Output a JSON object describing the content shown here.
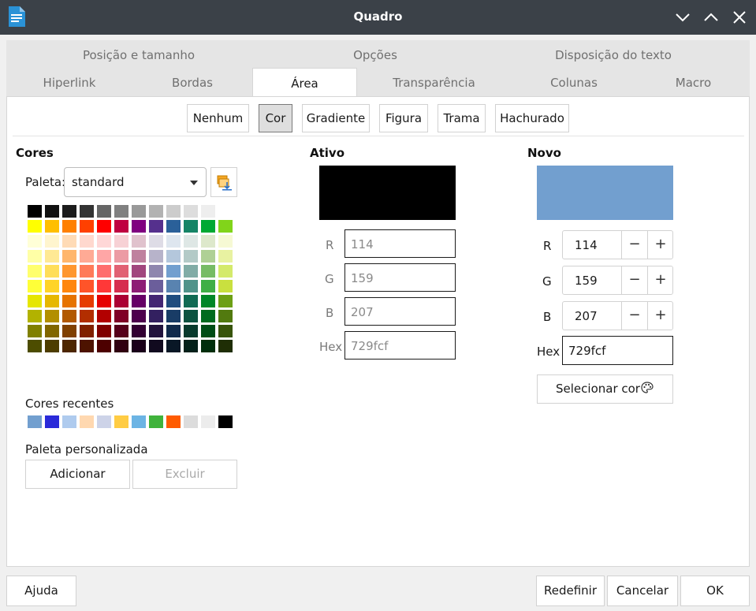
{
  "window": {
    "title": "Quadro"
  },
  "tabs": {
    "row1": [
      {
        "label": "Posição e tamanho"
      },
      {
        "label": "Opções"
      },
      {
        "label": "Disposição do texto"
      }
    ],
    "row2": [
      {
        "label": "Hiperlink"
      },
      {
        "label": "Bordas"
      },
      {
        "label": "Área"
      },
      {
        "label": "Transparência"
      },
      {
        "label": "Colunas"
      },
      {
        "label": "Macro"
      }
    ],
    "active": "Área"
  },
  "fill_types": [
    {
      "label": "Nenhum"
    },
    {
      "label": "Cor"
    },
    {
      "label": "Gradiente"
    },
    {
      "label": "Figura"
    },
    {
      "label": "Trama"
    },
    {
      "label": "Hachurado"
    }
  ],
  "cores": {
    "heading": "Cores",
    "palette_label": "Paleta:",
    "palette_value": "standard",
    "swatches": [
      [
        "#000000",
        "#111111",
        "#1c1c1c",
        "#333333",
        "#666666",
        "#808080",
        "#999999",
        "#b2b2b2",
        "#cccccc",
        "#dddddd",
        "#eeeeee",
        "#ffffff"
      ],
      [
        "#ffff00",
        "#ffbf00",
        "#ff8000",
        "#ff4000",
        "#ff0000",
        "#bf0041",
        "#800080",
        "#55308d",
        "#2a6099",
        "#158466",
        "#00a933",
        "#81d41a"
      ],
      [
        "#ffffd7",
        "#fff5ce",
        "#ffdbb6",
        "#ffd8ce",
        "#ffd7d7",
        "#f7d1d5",
        "#e0c2cd",
        "#dedce6",
        "#dee6ef",
        "#dee7e5",
        "#dde8cb",
        "#f6f9d4"
      ],
      [
        "#ffffa6",
        "#ffe994",
        "#ffb66c",
        "#ffaa95",
        "#ffa6a6",
        "#ec9ba4",
        "#bf819e",
        "#b7b3ca",
        "#b4c7dc",
        "#b3cac7",
        "#afd095",
        "#e8f2a1"
      ],
      [
        "#ffff6d",
        "#ffde59",
        "#ff972f",
        "#ff7b59",
        "#ff6d6d",
        "#e16173",
        "#a1467e",
        "#8e86ae",
        "#729fcf",
        "#81aca6",
        "#77bc65",
        "#d4ea6b"
      ],
      [
        "#ffff38",
        "#ffd428",
        "#ff860d",
        "#ff5429",
        "#ff3838",
        "#d62e4e",
        "#8d1d75",
        "#6b5e9b",
        "#5983b0",
        "#50938a",
        "#3faf46",
        "#c9e03f"
      ],
      [
        "#e6e600",
        "#e6b800",
        "#e67300",
        "#e63c00",
        "#e60000",
        "#ab0033",
        "#660066",
        "#442673",
        "#204d7f",
        "#106a53",
        "#008727",
        "#6da015"
      ],
      [
        "#b2b200",
        "#b28f00",
        "#b25900",
        "#b22e00",
        "#b20000",
        "#7f0026",
        "#4d004d",
        "#332060",
        "#193c66",
        "#0c5240",
        "#006b1e",
        "#527a0f"
      ],
      [
        "#808000",
        "#806600",
        "#804000",
        "#802000",
        "#800000",
        "#56001a",
        "#330033",
        "#22133d",
        "#112a4c",
        "#083a2d",
        "#004d15",
        "#38540a"
      ],
      [
        "#4d4d00",
        "#4d3d00",
        "#4d2600",
        "#4d1300",
        "#4d0000",
        "#300010",
        "#1a001a",
        "#110a1f",
        "#091726",
        "#04211a",
        "#002e0c",
        "#1f2e05"
      ]
    ],
    "recent_label": "Cores recentes",
    "recent": [
      "#729fcf",
      "#2a2ad9",
      "#afcbee",
      "#ffd8b0",
      "#cdd3e8",
      "#ffcc44",
      "#6cb4e4",
      "#40b33c",
      "#ff5b00",
      "#dcdcdc",
      "#ececec",
      "#000000"
    ],
    "custom_label": "Paleta personalizada",
    "add_label": "Adicionar",
    "delete_label": "Excluir"
  },
  "ativo": {
    "heading": "Ativo",
    "color": "#000000",
    "r_label": "R",
    "r": "114",
    "g_label": "G",
    "g": "159",
    "b_label": "B",
    "b": "207",
    "hex_label": "Hex",
    "hex": "729fcf"
  },
  "novo": {
    "heading": "Novo",
    "color": "#729fcf",
    "r_label": "R",
    "r": "114",
    "g_label": "G",
    "g": "159",
    "b_label": "B",
    "b": "207",
    "hex_label": "Hex",
    "hex": "729fcf",
    "minus": "−",
    "plus": "+",
    "pick_label": "Selecionar cor"
  },
  "footer": {
    "help": "Ajuda",
    "reset": "Redefinir",
    "cancel": "Cancelar",
    "ok": "OK"
  },
  "colors": {
    "titlebar": "#3b4148",
    "app_icon": "#2a92d6"
  }
}
